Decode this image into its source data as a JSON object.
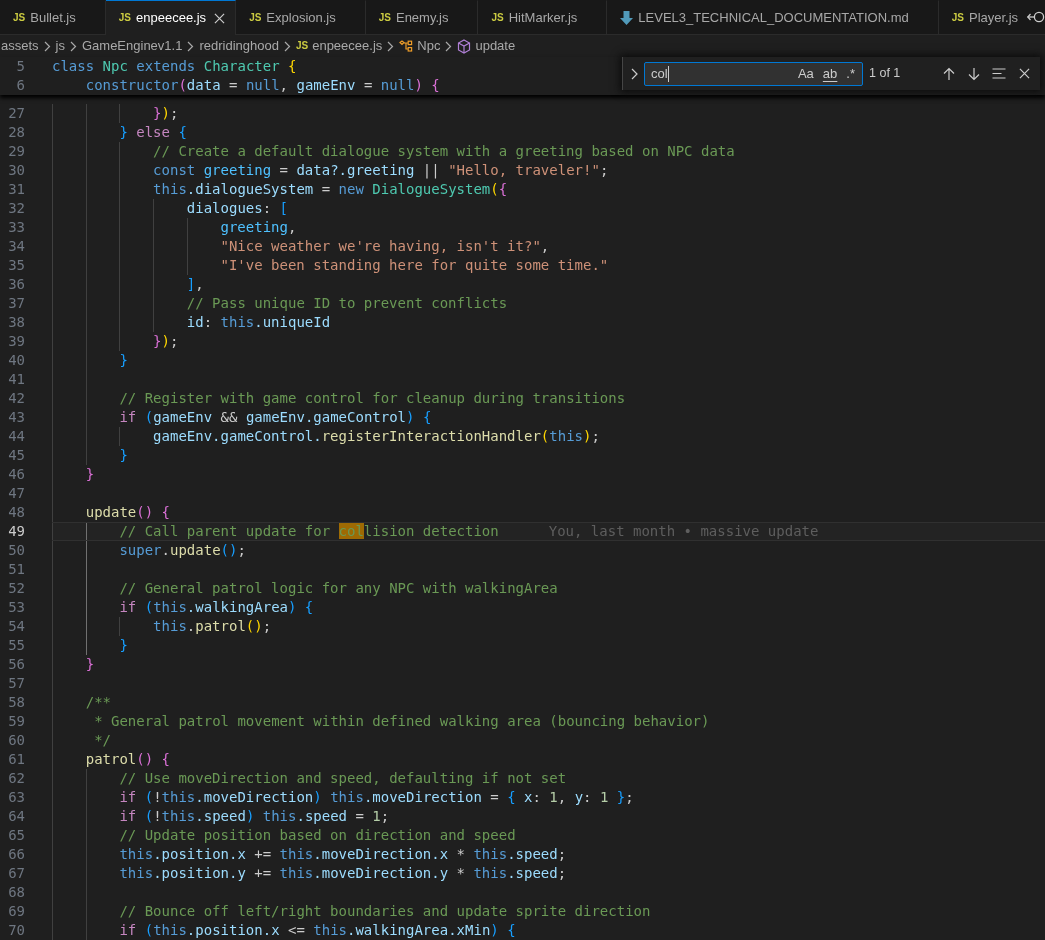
{
  "tabs": [
    {
      "kind": "js",
      "badge": "JS",
      "label": "Bullet.js",
      "selected": false
    },
    {
      "kind": "js",
      "badge": "JS",
      "label": "enpeecee.js",
      "selected": true
    },
    {
      "kind": "js",
      "badge": "JS",
      "label": "Explosion.js",
      "selected": false
    },
    {
      "kind": "js",
      "badge": "JS",
      "label": "Enemy.js",
      "selected": false
    },
    {
      "kind": "js",
      "badge": "JS",
      "label": "HitMarker.js",
      "selected": false
    },
    {
      "kind": "markdown",
      "label": "LEVEL3_TECHNICAL_DOCUMENTATION.md",
      "selected": false
    },
    {
      "kind": "js",
      "badge": "JS",
      "label": "Player.js",
      "selected": false
    }
  ],
  "breadcrumb": [
    {
      "kind": "folder",
      "label": "assets"
    },
    {
      "kind": "folder",
      "label": "js"
    },
    {
      "kind": "folder",
      "label": "GameEnginev1.1"
    },
    {
      "kind": "folder",
      "label": "redridinghood"
    },
    {
      "kind": "file",
      "badge": "JS",
      "label": "enpeecee.js"
    },
    {
      "kind": "class",
      "label": "Npc"
    },
    {
      "kind": "method",
      "label": "update"
    }
  ],
  "sticky_scroll": [
    {
      "number": "5",
      "tokens": [
        {
          "kind": "keyword",
          "text": "class "
        },
        {
          "kind": "type",
          "text": "Npc "
        },
        {
          "kind": "keyword",
          "text": "extends "
        },
        {
          "kind": "type",
          "text": "Character "
        },
        {
          "kind": "bracket1",
          "text": "{"
        }
      ]
    },
    {
      "number": "6",
      "tokens": [
        {
          "kind": "keyword",
          "text": "    constructor"
        },
        {
          "kind": "bracket2",
          "text": "("
        },
        {
          "kind": "variable",
          "text": "data"
        },
        {
          "kind": "plain",
          "text": " = "
        },
        {
          "kind": "keyword",
          "text": "null"
        },
        {
          "kind": "plain",
          "text": ", "
        },
        {
          "kind": "variable",
          "text": "gameEnv"
        },
        {
          "kind": "plain",
          "text": " = "
        },
        {
          "kind": "keyword",
          "text": "null"
        },
        {
          "kind": "bracket2",
          "text": ") {"
        }
      ]
    }
  ],
  "find_widget": {
    "replace_expanded": false,
    "input": {
      "value": "col"
    },
    "toggles": [
      {
        "kind": "case",
        "label": "Aa",
        "on": false
      },
      {
        "kind": "word",
        "label": "ab",
        "on": false
      },
      {
        "kind": "regex",
        "label": ".*",
        "on": false
      }
    ],
    "result": "1 of 1"
  },
  "lines": [
    {
      "number": "27",
      "current": false,
      "tokens": [
        {
          "kind": "bracket2",
          "text": "            }"
        },
        {
          "kind": "bracket1",
          "text": ")"
        },
        {
          "kind": "plain",
          "text": ";"
        }
      ]
    },
    {
      "number": "28",
      "current": false,
      "tokens": [
        {
          "kind": "bracket3",
          "text": "        } "
        },
        {
          "kind": "control",
          "text": "else "
        },
        {
          "kind": "bracket3",
          "text": "{"
        }
      ]
    },
    {
      "number": "29",
      "current": false,
      "tokens": [
        {
          "kind": "comment",
          "text": "            // Create a default dialogue system with a greeting based on NPC data"
        }
      ]
    },
    {
      "number": "30",
      "current": false,
      "tokens": [
        {
          "kind": "keyword",
          "text": "            const "
        },
        {
          "kind": "constant",
          "text": "greeting"
        },
        {
          "kind": "plain",
          "text": " = "
        },
        {
          "kind": "variable",
          "text": "data?.greeting"
        },
        {
          "kind": "plain",
          "text": " || "
        },
        {
          "kind": "string",
          "text": "\"Hello, traveler!\""
        },
        {
          "kind": "plain",
          "text": ";"
        }
      ]
    },
    {
      "number": "31",
      "current": false,
      "tokens": [
        {
          "kind": "keyword",
          "text": "            this"
        },
        {
          "kind": "variable",
          "text": ".dialogueSystem"
        },
        {
          "kind": "plain",
          "text": " = "
        },
        {
          "kind": "keyword",
          "text": "new "
        },
        {
          "kind": "type",
          "text": "DialogueSystem"
        },
        {
          "kind": "bracket1",
          "text": "("
        },
        {
          "kind": "bracket2",
          "text": "{"
        }
      ]
    },
    {
      "number": "32",
      "current": false,
      "tokens": [
        {
          "kind": "variable",
          "text": "                dialogues"
        },
        {
          "kind": "plain",
          "text": ": "
        },
        {
          "kind": "bracket3",
          "text": "["
        }
      ]
    },
    {
      "number": "33",
      "current": false,
      "tokens": [
        {
          "kind": "constant",
          "text": "                    greeting"
        },
        {
          "kind": "plain",
          "text": ","
        }
      ]
    },
    {
      "number": "34",
      "current": false,
      "tokens": [
        {
          "kind": "string",
          "text": "                    \"Nice weather we're having, isn't it?\""
        },
        {
          "kind": "plain",
          "text": ","
        }
      ]
    },
    {
      "number": "35",
      "current": false,
      "tokens": [
        {
          "kind": "string",
          "text": "                    \"I've been standing here for quite some time.\""
        }
      ]
    },
    {
      "number": "36",
      "current": false,
      "tokens": [
        {
          "kind": "bracket3",
          "text": "                ]"
        },
        {
          "kind": "plain",
          "text": ","
        }
      ]
    },
    {
      "number": "37",
      "current": false,
      "tokens": [
        {
          "kind": "comment",
          "text": "                // Pass unique ID to prevent conflicts"
        }
      ]
    },
    {
      "number": "38",
      "current": false,
      "tokens": [
        {
          "kind": "variable",
          "text": "                id"
        },
        {
          "kind": "plain",
          "text": ": "
        },
        {
          "kind": "keyword",
          "text": "this"
        },
        {
          "kind": "variable",
          "text": ".uniqueId"
        }
      ]
    },
    {
      "number": "39",
      "current": false,
      "tokens": [
        {
          "kind": "bracket2",
          "text": "            }"
        },
        {
          "kind": "bracket1",
          "text": ")"
        },
        {
          "kind": "plain",
          "text": ";"
        }
      ]
    },
    {
      "number": "40",
      "current": false,
      "tokens": [
        {
          "kind": "bracket3",
          "text": "        }"
        }
      ]
    },
    {
      "number": "41",
      "current": false
    },
    {
      "number": "42",
      "current": false,
      "tokens": [
        {
          "kind": "comment",
          "text": "        // Register with game control for cleanup during transitions"
        }
      ]
    },
    {
      "number": "43",
      "current": false,
      "tokens": [
        {
          "kind": "control",
          "text": "        if "
        },
        {
          "kind": "bracket3",
          "text": "("
        },
        {
          "kind": "variable",
          "text": "gameEnv"
        },
        {
          "kind": "plain",
          "text": " && "
        },
        {
          "kind": "variable",
          "text": "gameEnv.gameControl"
        },
        {
          "kind": "bracket3",
          "text": ") {"
        }
      ]
    },
    {
      "number": "44",
      "current": false,
      "tokens": [
        {
          "kind": "variable",
          "text": "            gameEnv.gameControl."
        },
        {
          "kind": "function",
          "text": "registerInteractionHandler"
        },
        {
          "kind": "bracket1",
          "text": "("
        },
        {
          "kind": "keyword",
          "text": "this"
        },
        {
          "kind": "bracket1",
          "text": ")"
        },
        {
          "kind": "plain",
          "text": ";"
        }
      ]
    },
    {
      "number": "45",
      "current": false,
      "tokens": [
        {
          "kind": "bracket3",
          "text": "        }"
        }
      ]
    },
    {
      "number": "46",
      "current": false,
      "tokens": [
        {
          "kind": "bracket2",
          "text": "    }"
        }
      ]
    },
    {
      "number": "47",
      "current": false
    },
    {
      "number": "48",
      "current": false,
      "tokens": [
        {
          "kind": "function",
          "text": "    update"
        },
        {
          "kind": "bracket2",
          "text": "() {"
        }
      ]
    },
    {
      "number": "49",
      "current": true,
      "tokens": [
        {
          "kind": "comment",
          "text": "        // Call parent update for "
        },
        {
          "kind": "match",
          "text": "col"
        },
        {
          "kind": "comment",
          "text": "lision detection"
        }
      ],
      "blame": "You, last month • massive update"
    },
    {
      "number": "50",
      "current": false,
      "tokens": [
        {
          "kind": "keyword",
          "text": "        super"
        },
        {
          "kind": "plain",
          "text": "."
        },
        {
          "kind": "function",
          "text": "update"
        },
        {
          "kind": "bracket3",
          "text": "()"
        },
        {
          "kind": "plain",
          "text": ";"
        }
      ]
    },
    {
      "number": "51",
      "current": false
    },
    {
      "number": "52",
      "current": false,
      "tokens": [
        {
          "kind": "comment",
          "text": "        // General patrol logic for any NPC with walkingArea"
        }
      ]
    },
    {
      "number": "53",
      "current": false,
      "tokens": [
        {
          "kind": "control",
          "text": "        if "
        },
        {
          "kind": "bracket3",
          "text": "("
        },
        {
          "kind": "keyword",
          "text": "this"
        },
        {
          "kind": "variable",
          "text": ".walkingArea"
        },
        {
          "kind": "bracket3",
          "text": ") {"
        }
      ]
    },
    {
      "number": "54",
      "current": false,
      "tokens": [
        {
          "kind": "keyword",
          "text": "            this"
        },
        {
          "kind": "plain",
          "text": "."
        },
        {
          "kind": "function",
          "text": "patrol"
        },
        {
          "kind": "bracket1",
          "text": "()"
        },
        {
          "kind": "plain",
          "text": ";"
        }
      ]
    },
    {
      "number": "55",
      "current": false,
      "tokens": [
        {
          "kind": "bracket3",
          "text": "        }"
        }
      ]
    },
    {
      "number": "56",
      "current": false,
      "tokens": [
        {
          "kind": "bracket2",
          "text": "    }"
        }
      ]
    },
    {
      "number": "57",
      "current": false
    },
    {
      "number": "58",
      "current": false,
      "tokens": [
        {
          "kind": "comment",
          "text": "    /**"
        }
      ]
    },
    {
      "number": "59",
      "current": false,
      "tokens": [
        {
          "kind": "comment",
          "text": "     * General patrol movement within defined walking area (bouncing behavior)"
        }
      ]
    },
    {
      "number": "60",
      "current": false,
      "tokens": [
        {
          "kind": "comment",
          "text": "     */"
        }
      ]
    },
    {
      "number": "61",
      "current": false,
      "tokens": [
        {
          "kind": "function",
          "text": "    patrol"
        },
        {
          "kind": "bracket2",
          "text": "() {"
        }
      ]
    },
    {
      "number": "62",
      "current": false,
      "tokens": [
        {
          "kind": "comment",
          "text": "        // Use moveDirection and speed, defaulting if not set"
        }
      ]
    },
    {
      "number": "63",
      "current": false,
      "tokens": [
        {
          "kind": "control",
          "text": "        if "
        },
        {
          "kind": "bracket3",
          "text": "("
        },
        {
          "kind": "plain",
          "text": "!"
        },
        {
          "kind": "keyword",
          "text": "this"
        },
        {
          "kind": "variable",
          "text": ".moveDirection"
        },
        {
          "kind": "bracket3",
          "text": ") "
        },
        {
          "kind": "keyword",
          "text": "this"
        },
        {
          "kind": "variable",
          "text": ".moveDirection"
        },
        {
          "kind": "plain",
          "text": " = "
        },
        {
          "kind": "bracket3",
          "text": "{"
        },
        {
          "kind": "variable",
          "text": " x"
        },
        {
          "kind": "plain",
          "text": ": "
        },
        {
          "kind": "number",
          "text": "1"
        },
        {
          "kind": "plain",
          "text": ", "
        },
        {
          "kind": "variable",
          "text": "y"
        },
        {
          "kind": "plain",
          "text": ": "
        },
        {
          "kind": "number",
          "text": "1 "
        },
        {
          "kind": "bracket3",
          "text": "}"
        },
        {
          "kind": "plain",
          "text": ";"
        }
      ]
    },
    {
      "number": "64",
      "current": false,
      "tokens": [
        {
          "kind": "control",
          "text": "        if "
        },
        {
          "kind": "bracket3",
          "text": "("
        },
        {
          "kind": "plain",
          "text": "!"
        },
        {
          "kind": "keyword",
          "text": "this"
        },
        {
          "kind": "variable",
          "text": ".speed"
        },
        {
          "kind": "bracket3",
          "text": ") "
        },
        {
          "kind": "keyword",
          "text": "this"
        },
        {
          "kind": "variable",
          "text": ".speed"
        },
        {
          "kind": "plain",
          "text": " = "
        },
        {
          "kind": "number",
          "text": "1"
        },
        {
          "kind": "plain",
          "text": ";"
        }
      ]
    },
    {
      "number": "65",
      "current": false,
      "tokens": [
        {
          "kind": "comment",
          "text": "        // Update position based on direction and speed"
        }
      ]
    },
    {
      "number": "66",
      "current": false,
      "tokens": [
        {
          "kind": "keyword",
          "text": "        this"
        },
        {
          "kind": "variable",
          "text": ".position.x"
        },
        {
          "kind": "plain",
          "text": " += "
        },
        {
          "kind": "keyword",
          "text": "this"
        },
        {
          "kind": "variable",
          "text": ".moveDirection.x"
        },
        {
          "kind": "plain",
          "text": " * "
        },
        {
          "kind": "keyword",
          "text": "this"
        },
        {
          "kind": "variable",
          "text": ".speed"
        },
        {
          "kind": "plain",
          "text": ";"
        }
      ]
    },
    {
      "number": "67",
      "current": false,
      "tokens": [
        {
          "kind": "keyword",
          "text": "        this"
        },
        {
          "kind": "variable",
          "text": ".position.y"
        },
        {
          "kind": "plain",
          "text": " += "
        },
        {
          "kind": "keyword",
          "text": "this"
        },
        {
          "kind": "variable",
          "text": ".moveDirection.y"
        },
        {
          "kind": "plain",
          "text": " * "
        },
        {
          "kind": "keyword",
          "text": "this"
        },
        {
          "kind": "variable",
          "text": ".speed"
        },
        {
          "kind": "plain",
          "text": ";"
        }
      ]
    },
    {
      "number": "68",
      "current": false
    },
    {
      "number": "69",
      "current": false,
      "tokens": [
        {
          "kind": "comment",
          "text": "        // Bounce off left/right boundaries and update sprite direction"
        }
      ]
    },
    {
      "number": "70",
      "current": false,
      "tokens": [
        {
          "kind": "control",
          "text": "        if "
        },
        {
          "kind": "bracket3",
          "text": "("
        },
        {
          "kind": "keyword",
          "text": "this"
        },
        {
          "kind": "variable",
          "text": ".position.x"
        },
        {
          "kind": "plain",
          "text": " <= "
        },
        {
          "kind": "keyword",
          "text": "this"
        },
        {
          "kind": "variable",
          "text": ".walkingArea.xMin"
        },
        {
          "kind": "bracket3",
          "text": ") {"
        }
      ]
    }
  ]
}
